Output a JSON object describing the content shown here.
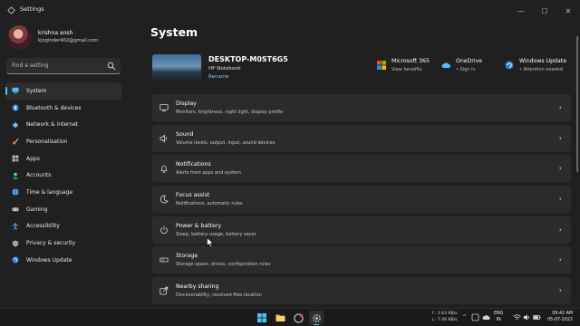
{
  "window": {
    "title": "Settings",
    "controls": {
      "minimize": "—",
      "maximize": "☐",
      "close": "✕"
    }
  },
  "profile": {
    "name": "krishna ansh",
    "email": "kjoginder402@gmail.com"
  },
  "search": {
    "placeholder": "Find a setting",
    "icon": "search-icon"
  },
  "sidebar": {
    "items": [
      {
        "label": "System",
        "icon": "monitor-icon",
        "color": "#4cc2ff",
        "active": true
      },
      {
        "label": "Bluetooth & devices",
        "icon": "bluetooth-icon",
        "color": "#4cc2ff"
      },
      {
        "label": "Network & internet",
        "icon": "wifi-icon",
        "color": "#6fc0ff"
      },
      {
        "label": "Personalisation",
        "icon": "brush-icon",
        "color": "#f0a35e"
      },
      {
        "label": "Apps",
        "icon": "apps-icon",
        "color": "#b9c4d0"
      },
      {
        "label": "Accounts",
        "icon": "person-icon",
        "color": "#4fd1a8"
      },
      {
        "label": "Time & language",
        "icon": "globe-icon",
        "color": "#5ab4ff"
      },
      {
        "label": "Gaming",
        "icon": "gamepad-icon",
        "color": "#c8c8c8"
      },
      {
        "label": "Accessibility",
        "icon": "accessibility-icon",
        "color": "#5fb3ff"
      },
      {
        "label": "Privacy & security",
        "icon": "shield-icon",
        "color": "#9aa4b0"
      },
      {
        "label": "Windows Update",
        "icon": "update-icon",
        "color": "#4cc2ff"
      }
    ]
  },
  "main": {
    "title": "System",
    "device": {
      "name": "DESKTOP-M0ST6G5",
      "model": "HP Notebook",
      "rename": "Rename"
    },
    "quick_links": [
      {
        "title": "Microsoft 365",
        "subtitle": "View benefits",
        "icon": "microsoft-logo-icon"
      },
      {
        "title": "OneDrive",
        "subtitle": "• Sign in",
        "icon": "cloud-icon"
      },
      {
        "title": "Windows Update",
        "subtitle": "• Attention needed",
        "icon": "update-icon"
      }
    ],
    "cards": [
      {
        "title": "Display",
        "subtitle": "Monitors, brightness, night light, display profile",
        "icon": "display-icon"
      },
      {
        "title": "Sound",
        "subtitle": "Volume levels, output, input, sound devices",
        "icon": "speaker-icon"
      },
      {
        "title": "Notifications",
        "subtitle": "Alerts from apps and system",
        "icon": "bell-icon"
      },
      {
        "title": "Focus assist",
        "subtitle": "Notifications, automatic rules",
        "icon": "moon-icon"
      },
      {
        "title": "Power & battery",
        "subtitle": "Sleep, battery usage, battery saver",
        "icon": "power-icon"
      },
      {
        "title": "Storage",
        "subtitle": "Storage space, drives, configuration rules",
        "icon": "storage-icon"
      },
      {
        "title": "Nearby sharing",
        "subtitle": "Discoverability, received files location",
        "icon": "share-icon"
      }
    ],
    "chevron": "›"
  },
  "taskbar": {
    "apps": [
      {
        "name": "start",
        "icon": "windows-logo-icon"
      },
      {
        "name": "file-explorer",
        "icon": "folder-icon"
      },
      {
        "name": "recorder",
        "icon": "recorder-icon"
      },
      {
        "name": "settings",
        "icon": "gear-icon",
        "active": true
      }
    ],
    "net_up": "↑: 2.63 KB/s",
    "net_down": "↓: 7.06 KB/s",
    "tray_arrow": "^",
    "lang_line1": "ENG",
    "lang_line2": "IN",
    "time": "09:42 AM",
    "date": "05-07-2022"
  }
}
